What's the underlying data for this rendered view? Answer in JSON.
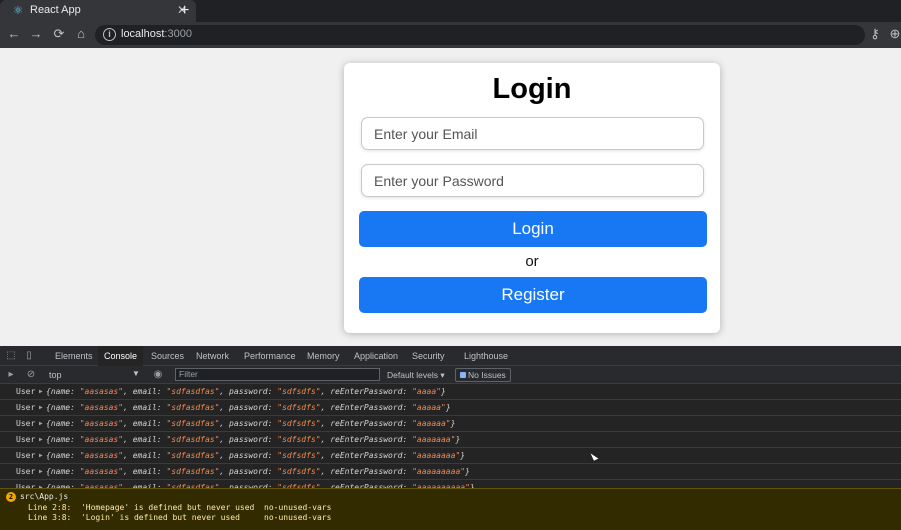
{
  "browser": {
    "tab_title": "React App",
    "tab_close": "✕",
    "new_tab": "+",
    "url_host": "localhost",
    "url_port": ":3000",
    "nav": {
      "back": "←",
      "forward": "→",
      "reload": "⟳",
      "home": "⌂",
      "key": "⚷",
      "zoom": "⊕"
    }
  },
  "login": {
    "title": "Login",
    "email_placeholder": "Enter your Email",
    "password_placeholder": "Enter your Password",
    "login_button": "Login",
    "or_text": "or",
    "register_button": "Register",
    "button_color": "#1877f2"
  },
  "devtools": {
    "tabs": [
      "Elements",
      "Console",
      "Sources",
      "Network",
      "Performance",
      "Memory",
      "Application",
      "Security",
      "Lighthouse"
    ],
    "active_tab": "Console",
    "context": "top",
    "filter_placeholder": "Filter",
    "levels": "Default levels ▾",
    "issues": "No Issues",
    "log_label": "User",
    "logs": [
      {
        "name": "\"aasasas\"",
        "email": "\"sdfasdfas\"",
        "password": "\"sdfsdfs\"",
        "re": "\"aaaa\""
      },
      {
        "name": "\"aasasas\"",
        "email": "\"sdfasdfas\"",
        "password": "\"sdfsdfs\"",
        "re": "\"aaaaa\""
      },
      {
        "name": "\"aasasas\"",
        "email": "\"sdfasdfas\"",
        "password": "\"sdfsdfs\"",
        "re": "\"aaaaaa\""
      },
      {
        "name": "\"aasasas\"",
        "email": "\"sdfasdfas\"",
        "password": "\"sdfsdfs\"",
        "re": "\"aaaaaaa\""
      },
      {
        "name": "\"aasasas\"",
        "email": "\"sdfasdfas\"",
        "password": "\"sdfsdfs\"",
        "re": "\"aaaaaaaa\""
      },
      {
        "name": "\"aasasas\"",
        "email": "\"sdfasdfas\"",
        "password": "\"sdfsdfs\"",
        "re": "\"aaaaaaaaa\""
      },
      {
        "name": "\"aasasas\"",
        "email": "\"sdfasdfas\"",
        "password": "\"sdfsdfs\"",
        "re": "\"aaaaaaaaaa\""
      }
    ],
    "warning": {
      "file": "src\\App.js",
      "line1": "Line 2:8:  'Homepage' is defined but never used  no-unused-vars",
      "line2": "Line 3:8:  'Login' is defined but never used     no-unused-vars"
    }
  }
}
